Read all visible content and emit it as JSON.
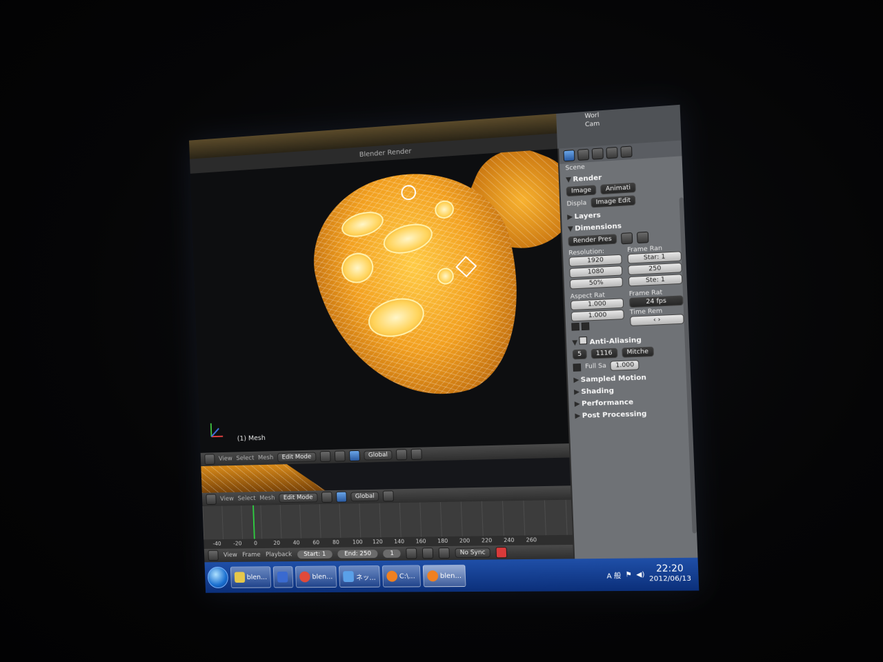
{
  "window": {
    "title": "Blender Render",
    "buttons": [
      "–",
      "□",
      "✕"
    ]
  },
  "viewport": {
    "object_label": "(1) Mesh"
  },
  "headers": {
    "menus": [
      "View",
      "Select",
      "Mesh"
    ],
    "mode": "Edit Mode",
    "orientation": "Global"
  },
  "timeline": {
    "menus": [
      "View",
      "Frame",
      "Playback"
    ],
    "ruler": [
      "-40",
      "-20",
      "0",
      "20",
      "40",
      "60",
      "80",
      "100",
      "120",
      "140",
      "160",
      "180",
      "200",
      "220",
      "240",
      "260"
    ],
    "start": "Start: 1",
    "end": "End: 250",
    "current": "1",
    "sync": "No Sync"
  },
  "outliner": {
    "items": [
      "Worl",
      "Cam"
    ]
  },
  "properties": {
    "scene_label": "Scene",
    "render": {
      "title": "Render",
      "image_btn": "Image",
      "animation_btn": "Animati",
      "display_label": "Displa",
      "display_value": "Image Edit"
    },
    "layers": "Layers",
    "dimensions": {
      "title": "Dimensions",
      "preset": "Render Pres",
      "resolution_label": "Resolution:",
      "res_x": "1920",
      "res_y": "1080",
      "res_pct": "50%",
      "frame_range_label": "Frame Ran",
      "start": "Star: 1",
      "end": "250",
      "step": "Ste: 1",
      "aspect_label": "Aspect Rat",
      "aspect_x": "1.000",
      "aspect_y": "1.000",
      "frame_rate_label": "Frame Rat",
      "fps": "24 fps",
      "time_remap_label": "Time Rem"
    },
    "anti_aliasing": {
      "title": "Anti-Aliasing",
      "samples_a": "5",
      "samples_b": "1116",
      "filter": "Mitche",
      "full_sample": "Full Sa",
      "size": "1.000"
    },
    "sampled_motion": "Sampled Motion",
    "shading": "Shading",
    "performance": "Performance",
    "post_processing": "Post Processing"
  },
  "taskbar": {
    "tasks": [
      {
        "label": "blen...",
        "color": "#e6c84a"
      },
      {
        "label": "",
        "color": "#3a6ad0"
      },
      {
        "label": "blen...",
        "color": "#e04a3a"
      },
      {
        "label": "ネッ...",
        "color": "#5aa0e8"
      },
      {
        "label": "C:\\...",
        "color": "#f08020"
      },
      {
        "label": "blen...",
        "color": "#f08020"
      }
    ],
    "ime": "A 般",
    "time": "22:20",
    "date": "2012/06/13"
  }
}
